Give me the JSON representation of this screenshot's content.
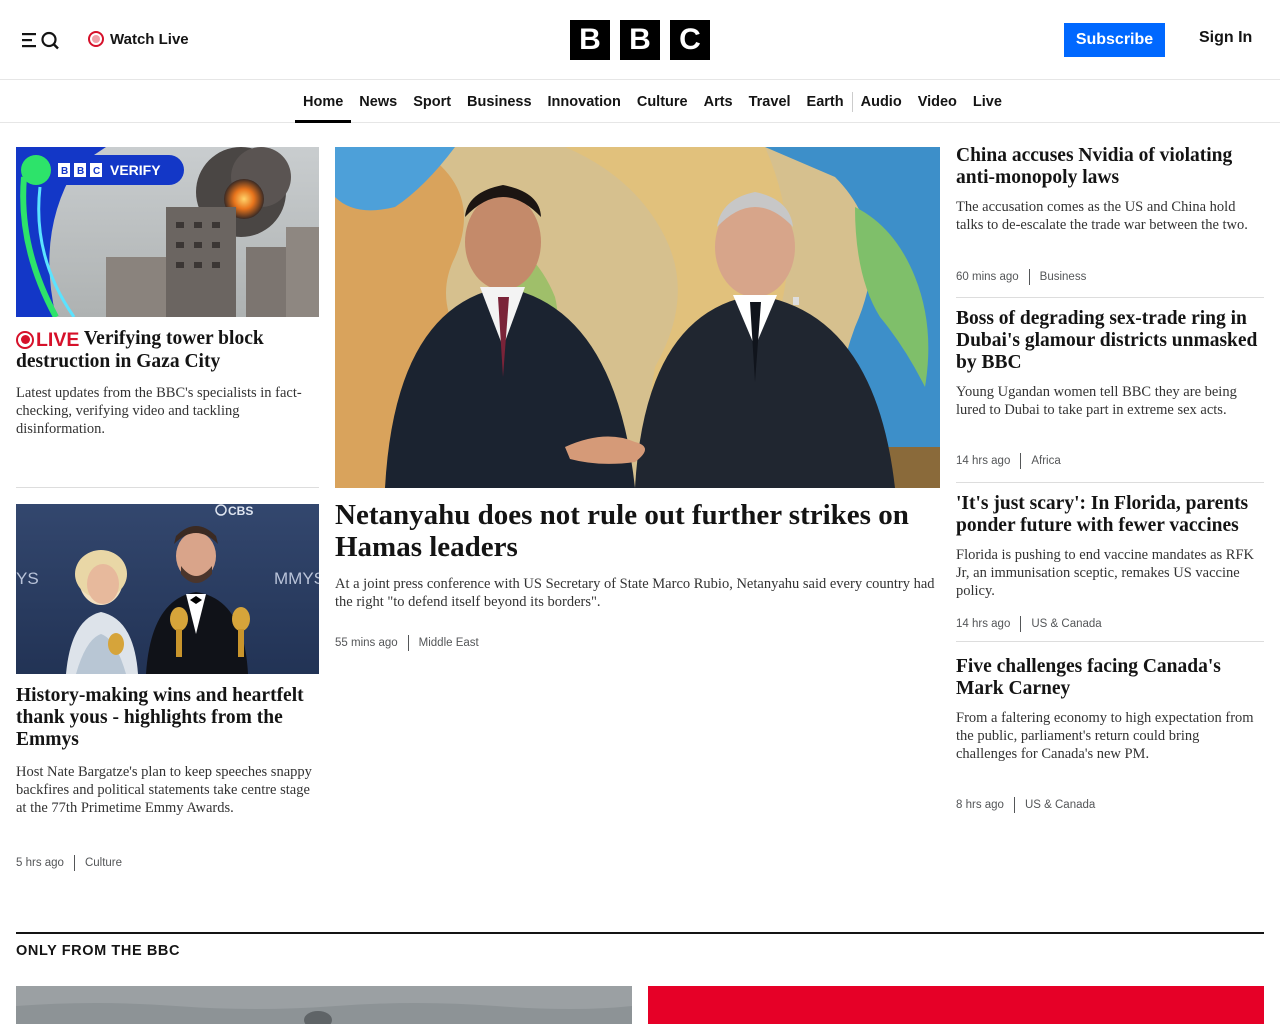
{
  "header": {
    "watch_live": "Watch Live",
    "logo_letters": [
      "B",
      "B",
      "C"
    ],
    "subscribe": "Subscribe",
    "sign_in": "Sign In"
  },
  "nav": {
    "items": [
      "Home",
      "News",
      "Sport",
      "Business",
      "Innovation",
      "Culture",
      "Arts",
      "Travel",
      "Earth",
      "Audio",
      "Video",
      "Live"
    ],
    "active": "Home"
  },
  "left": {
    "story1": {
      "image_badge": "VERIFY",
      "live_label": "LIVE",
      "headline": "Verifying tower block destruction in Gaza City",
      "summary": "Latest updates from the BBC's specialists in fact-checking, verifying video and tackling disinformation."
    },
    "story2": {
      "image_watermark": "CBS",
      "image_backdrop": "MMYS",
      "headline": "History-making wins and heartfelt thank yous - highlights from the Emmys",
      "summary": "Host Nate Bargatze's plan to keep speeches snappy backfires and political statements take centre stage at the 77th Primetime Emmy Awards.",
      "time": "5 hrs ago",
      "tag": "Culture"
    }
  },
  "main": {
    "headline": "Netanyahu does not rule out further strikes on Hamas leaders",
    "summary": "At a joint press conference with US Secretary of State Marco Rubio, Netanyahu said every country had the right \"to defend itself beyond its borders\".",
    "time": "55 mins ago",
    "tag": "Middle East"
  },
  "right": [
    {
      "headline": "China accuses Nvidia of violating anti-monopoly laws",
      "summary": "The accusation comes as the US and China hold talks to de-escalate the trade war between the two.",
      "time": "60 mins ago",
      "tag": "Business"
    },
    {
      "headline": "Boss of degrading sex-trade ring in Dubai's glamour districts unmasked by BBC",
      "summary": "Young Ugandan women tell BBC they are being lured to Dubai to take part in extreme sex acts.",
      "time": "14 hrs ago",
      "tag": "Africa"
    },
    {
      "headline": "'It's just scary': In Florida, parents ponder future with fewer vaccines",
      "summary": "Florida is pushing to end vaccine mandates as RFK Jr, an immunisation sceptic, remakes US vaccine policy.",
      "time": "14 hrs ago",
      "tag": "US & Canada"
    },
    {
      "headline": "Five challenges facing Canada's Mark Carney",
      "summary": "From a faltering economy to high expectation from the public, parliament's return could bring challenges for Canada's new PM.",
      "time": "8 hrs ago",
      "tag": "US & Canada"
    }
  ],
  "section": {
    "title": "ONLY FROM THE BBC"
  },
  "colors": {
    "subscribe_bg": "#0068ff",
    "live_red": "#d6112a",
    "text": "#141414"
  }
}
